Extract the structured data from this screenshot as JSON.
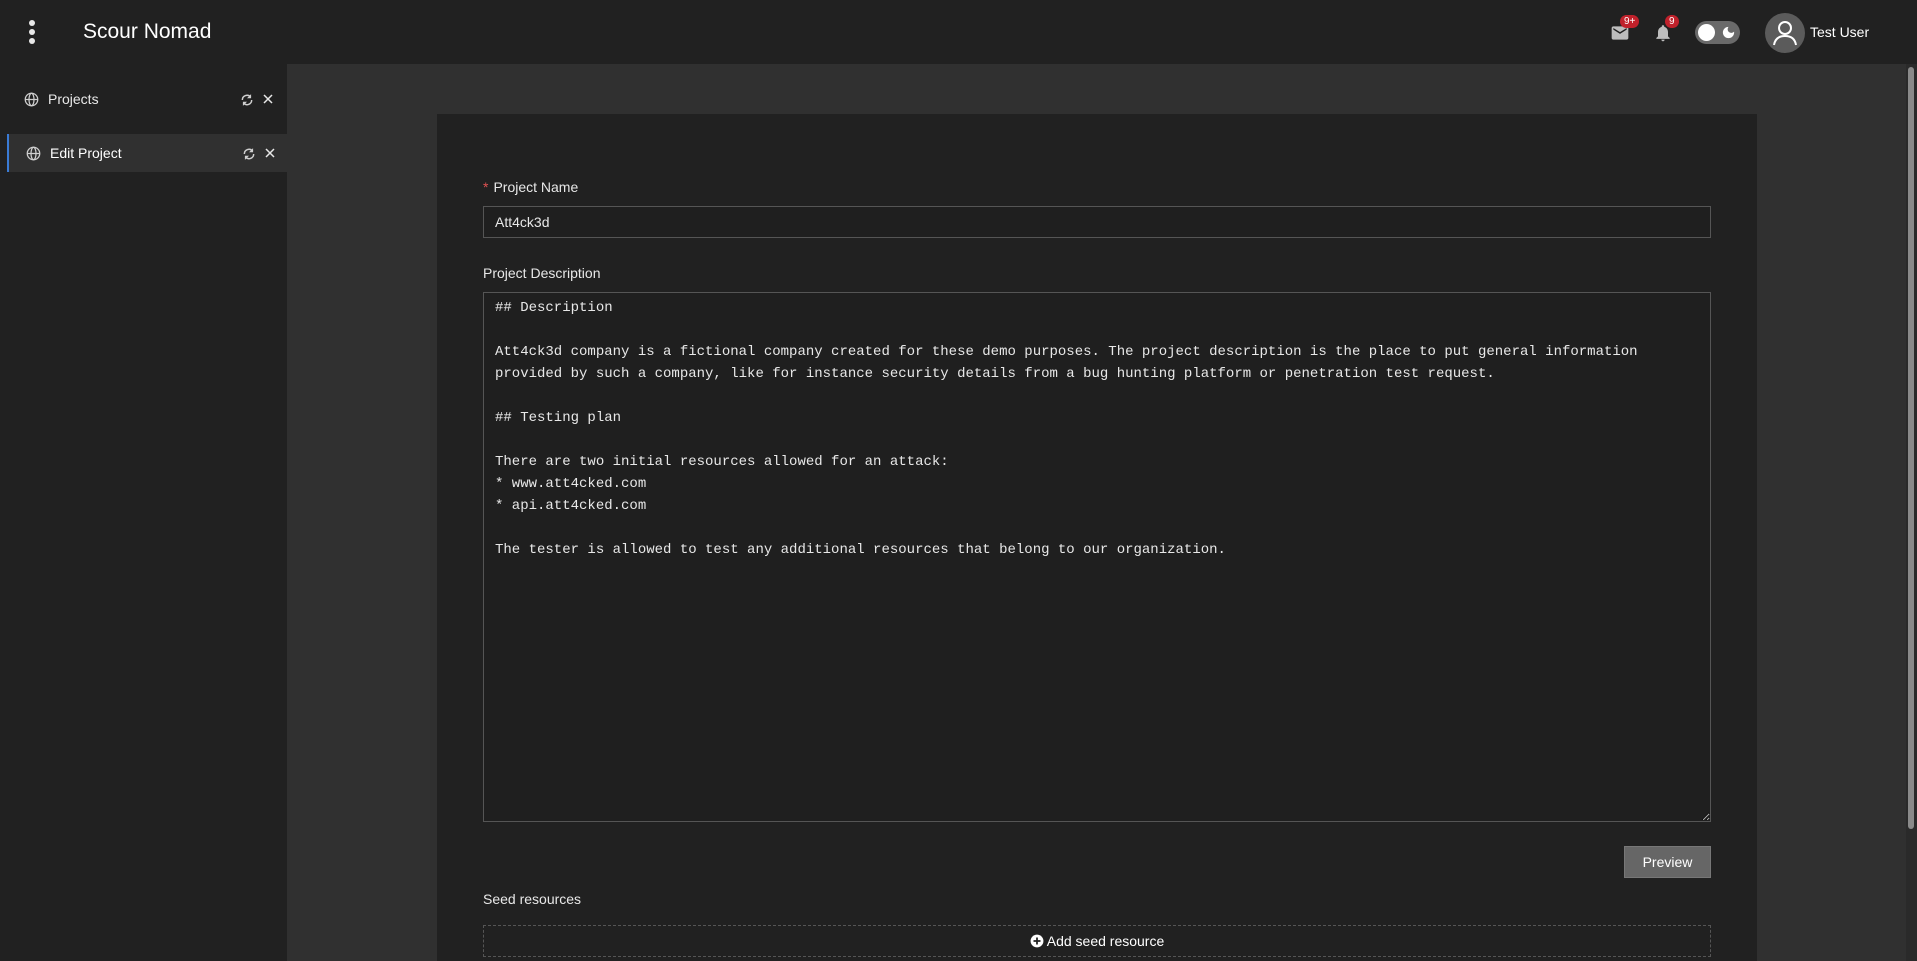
{
  "app": {
    "title": "Scour Nomad"
  },
  "header": {
    "mail_badge": "9+",
    "notification_badge": "9",
    "user_name": "Test User"
  },
  "sidebar": {
    "items": [
      {
        "label": "Projects",
        "icon": "globe-icon",
        "active": false
      },
      {
        "label": "Edit Project",
        "icon": "globe-icon",
        "active": true
      }
    ]
  },
  "form": {
    "project_name_label": "Project Name",
    "project_name_value": "Att4ck3d",
    "project_description_label": "Project Description",
    "project_description_value": "## Description\n\nAtt4ck3d company is a fictional company created for these demo purposes. The project description is the place to put general information provided by such a company, like for instance security details from a bug hunting platform or penetration test request.\n\n## Testing plan\n\nThere are two initial resources allowed for an attack:\n* www.att4cked.com\n* api.att4cked.com\n\nThe tester is allowed to test any additional resources that belong to our organization.",
    "preview_label": "Preview",
    "seed_resources_label": "Seed resources",
    "add_seed_label": "Add seed resource"
  },
  "colors": {
    "accent": "#3a7bd5",
    "badge": "#c0212b",
    "required": "#e05252"
  }
}
